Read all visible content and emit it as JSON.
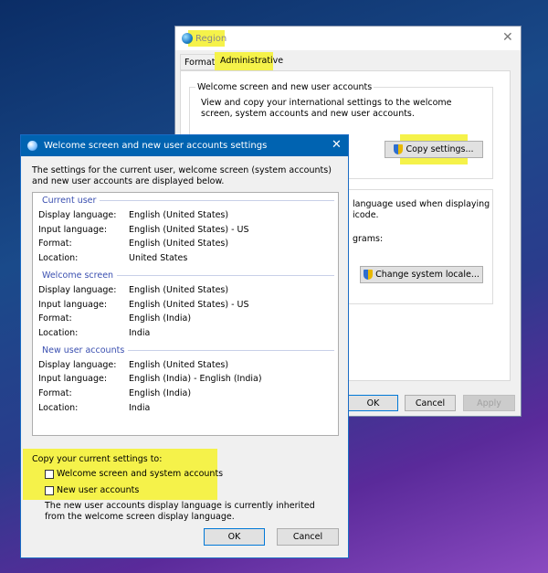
{
  "region": {
    "title": "Region",
    "tabs": [
      "Formats",
      "Administrative"
    ],
    "active_tab": "Administrative",
    "group1": {
      "title": "Welcome screen and new user accounts",
      "desc": "View and copy your international settings to the welcome screen, system accounts and new user accounts.",
      "button": "Copy settings..."
    },
    "group2": {
      "text1": "language used when displaying",
      "text2": "icode.",
      "text3": "grams:",
      "button": "Change system locale..."
    },
    "buttons": {
      "ok": "OK",
      "cancel": "Cancel",
      "apply": "Apply"
    }
  },
  "dialog": {
    "title": "Welcome screen and new user accounts settings",
    "intro": "The settings for the current user, welcome screen (system accounts) and new user accounts are displayed below.",
    "sections": [
      {
        "title": "Current user",
        "rows": [
          [
            "Display language:",
            "English (United States)"
          ],
          [
            "Input language:",
            "English (United States) - US"
          ],
          [
            "Format:",
            "English (United States)"
          ],
          [
            "Location:",
            "United States"
          ]
        ]
      },
      {
        "title": "Welcome screen",
        "rows": [
          [
            "Display language:",
            "English (United States)"
          ],
          [
            "Input language:",
            "English (United States) - US"
          ],
          [
            "Format:",
            "English (India)"
          ],
          [
            "Location:",
            "India"
          ]
        ]
      },
      {
        "title": "New user accounts",
        "rows": [
          [
            "Display language:",
            "English (United States)"
          ],
          [
            "Input language:",
            "English (India) - English (India)"
          ],
          [
            "Format:",
            "English (India)"
          ],
          [
            "Location:",
            "India"
          ]
        ]
      }
    ],
    "copy_label": "Copy your current settings to:",
    "checkboxes": [
      {
        "label": "Welcome screen and system accounts",
        "checked": false
      },
      {
        "label": "New user accounts",
        "checked": false
      }
    ],
    "note": "The new user accounts display language is currently inherited from the welcome screen display language.",
    "ok": "OK",
    "cancel": "Cancel"
  },
  "colors": {
    "highlight": "#f5f24a",
    "titlebar": "#0063b1",
    "section": "#3a4fb0"
  }
}
